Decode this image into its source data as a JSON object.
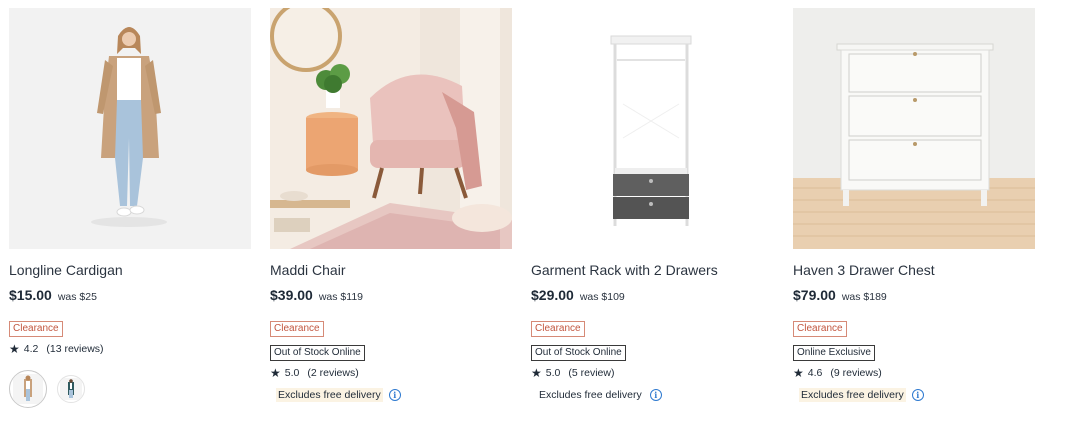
{
  "products": [
    {
      "name": "Longline Cardigan",
      "price": "$15.00",
      "was": "was $25",
      "badges": [
        "Clearance"
      ],
      "rating": "4.2",
      "reviews": "(13 reviews)",
      "swatches": [
        "oatmeal-cardigan-swatch",
        "teal-cardigan-swatch"
      ]
    },
    {
      "name": "Maddi Chair",
      "price": "$39.00",
      "was": "was $119",
      "badges": [
        "Clearance",
        "Out of Stock Online"
      ],
      "rating": "5.0",
      "reviews": "(2 reviews)",
      "delivery": "Excludes free delivery"
    },
    {
      "name": "Garment Rack with 2 Drawers",
      "price": "$29.00",
      "was": "was $109",
      "badges": [
        "Clearance",
        "Out of Stock Online"
      ],
      "rating": "5.0",
      "reviews": "(5 review)",
      "delivery": "Excludes free delivery"
    },
    {
      "name": "Haven 3 Drawer Chest",
      "price": "$79.00",
      "was": "was $189",
      "badges": [
        "Clearance",
        "Online Exclusive"
      ],
      "rating": "4.6",
      "reviews": "(9 reviews)",
      "delivery": "Excludes free delivery"
    }
  ],
  "icons": {
    "star": "★",
    "info": "i"
  },
  "colors": {
    "clearance": "#c2563f",
    "info_icon": "#2f7ad0",
    "delivery_bg": "#fbf3e3"
  }
}
